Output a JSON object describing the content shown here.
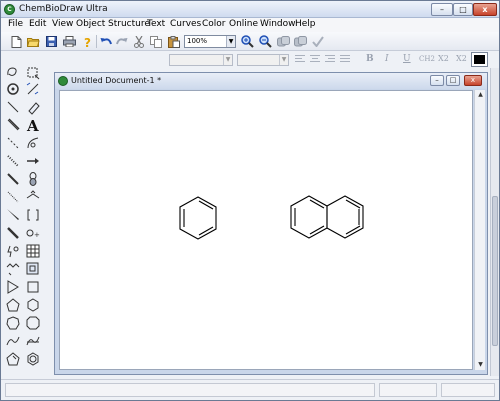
{
  "app": {
    "title": "ChemBioDraw Ultra",
    "icon_label": "C"
  },
  "window_controls": {
    "minimize": "–",
    "maximize": "□",
    "close": "x"
  },
  "menu": [
    "File",
    "Edit",
    "View",
    "Object",
    "Structure",
    "Text",
    "Curves",
    "Color",
    "Online",
    "Window",
    "Help"
  ],
  "toolbar": {
    "zoom_value": "100%",
    "icons": [
      "new-icon",
      "open-icon",
      "save-icon",
      "print-icon",
      "help-icon",
      "undo-icon",
      "redo-icon",
      "cut-icon",
      "copy-icon",
      "paste-icon",
      "zoom-in-icon",
      "zoom-out-icon",
      "structure-icon",
      "structure-icon-2",
      "check-icon"
    ]
  },
  "stylebar": {
    "buttons": [
      "B",
      "I",
      "U",
      "CH2",
      "X2",
      "X2"
    ],
    "color_value": "#000000"
  },
  "document": {
    "title": "Untitled Document-1 *",
    "molecules": [
      "benzene",
      "naphthalene"
    ]
  },
  "palette": {
    "tools": [
      "lasso-icon",
      "marquee-icon",
      "rotate-icon",
      "mass-fragment-icon",
      "solid-bond-icon",
      "eraser-icon",
      "bold-bond-icon",
      "text-icon",
      "dashed-bond-icon",
      "pen-icon",
      "hashed-bond-icon",
      "arrow-icon",
      "wedge-bond-icon",
      "orbital-icon",
      "wavy-bond-icon",
      "drawing-elements-icon",
      "hashed-wedge-icon",
      "bracket-icon",
      "wedged-bond-icon",
      "chemical-symbol-icon",
      "query-icon",
      "table-icon",
      "chain-icon",
      "template-icon",
      "triangle-icon",
      "square-icon",
      "pentagon-icon",
      "hexagon-icon",
      "heptagon-icon",
      "circle-icon",
      "cyclopentane-icon",
      "cyclohexane-icon",
      "benzene-ring-icon",
      "cyclohexane-chair-icon"
    ]
  }
}
